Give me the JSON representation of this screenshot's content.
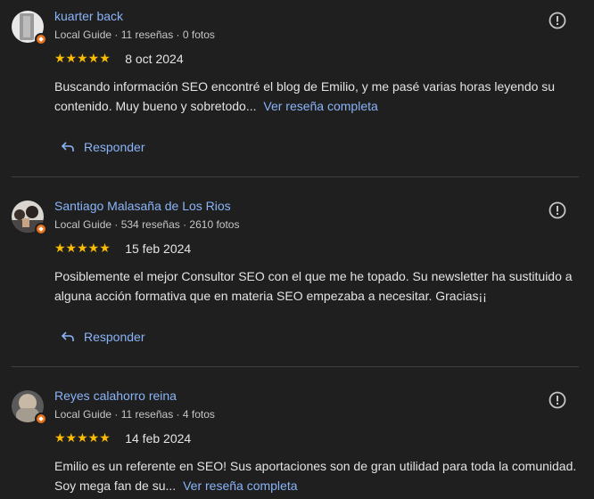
{
  "reviews": [
    {
      "name": "kuarter back",
      "meta": "Local Guide · 11 reseñas · 0 fotos",
      "stars": "★★★★★",
      "rating": 5,
      "date": "8 oct 2024",
      "text": "Buscando información SEO encontré el blog de Emilio, y me pasé varias horas leyendo su contenido. Muy bueno y sobretodo...",
      "more_label": "Ver reseña completa",
      "reply_label": "Responder"
    },
    {
      "name": "Santiago Malasaña de Los Rios",
      "meta": "Local Guide · 534 reseñas · 2610 fotos",
      "stars": "★★★★★",
      "rating": 5,
      "date": "15 feb 2024",
      "text": "Posiblemente el mejor Consultor SEO con el que me he topado. Su newsletter ha sustituido a alguna acción formativa que en materia SEO empezaba a necesitar. Gracias¡¡",
      "more_label": "",
      "reply_label": "Responder"
    },
    {
      "name": "Reyes calahorro reina",
      "meta": "Local Guide · 11 reseñas · 4 fotos",
      "stars": "★★★★★",
      "rating": 5,
      "date": "14 feb 2024",
      "text": "Emilio es un referente en SEO! Sus aportaciones son de gran utilidad para toda la comunidad. Soy mega fan de su...",
      "more_label": "Ver reseña completa",
      "reply_label": ""
    }
  ],
  "colors": {
    "background": "#1f1f1f",
    "link": "#8ab4f8",
    "star": "#fbbc04",
    "local_guide_badge": "#e8711a"
  },
  "icons": [
    "avatar",
    "local-guide-badge",
    "report-icon",
    "reply-arrow-icon",
    "star-icon"
  ]
}
